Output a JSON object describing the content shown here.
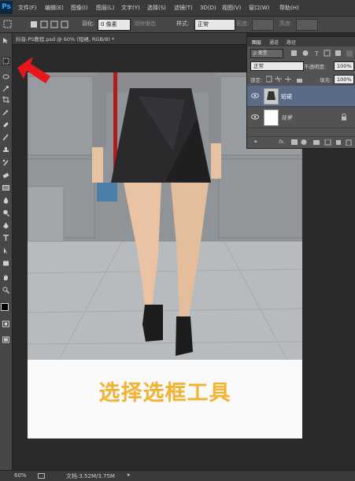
{
  "app": {
    "logo": "Ps"
  },
  "menu": [
    "文件(F)",
    "编辑(E)",
    "图像(I)",
    "图层(L)",
    "文字(Y)",
    "选择(S)",
    "滤镜(T)",
    "3D(D)",
    "视图(V)",
    "窗口(W)",
    "帮助(H)"
  ],
  "options": {
    "feather_label": "羽化:",
    "feather_value": "0 像素",
    "antialias_label": "消除锯齿",
    "style_label": "样式:",
    "style_value": "正常",
    "width_label": "宽度:",
    "height_label": "高度:"
  },
  "document": {
    "tab_title": "抖音-PS教程.psd @ 60% (短裙, RGB/8) *"
  },
  "caption": "选择选框工具",
  "layers_panel": {
    "tabs": [
      "图层",
      "通道",
      "路径"
    ],
    "filter_kind": "类型",
    "blend_mode": "正常",
    "opacity_label": "不透明度:",
    "opacity_value": "100%",
    "lock_label": "锁定:",
    "fill_label": "填充:",
    "fill_value": "100%",
    "layers": [
      {
        "name": "短裙",
        "selected": true
      },
      {
        "name": "背景",
        "locked": true
      }
    ],
    "footer_text": "fx."
  },
  "status": {
    "zoom": "60%",
    "doc_size": "文档:3.52M/3.75M"
  },
  "colors": {
    "caption": "#f2b233",
    "arrow": "#e8151b",
    "panel": "#535353",
    "selected_layer": "#5a6b88"
  }
}
